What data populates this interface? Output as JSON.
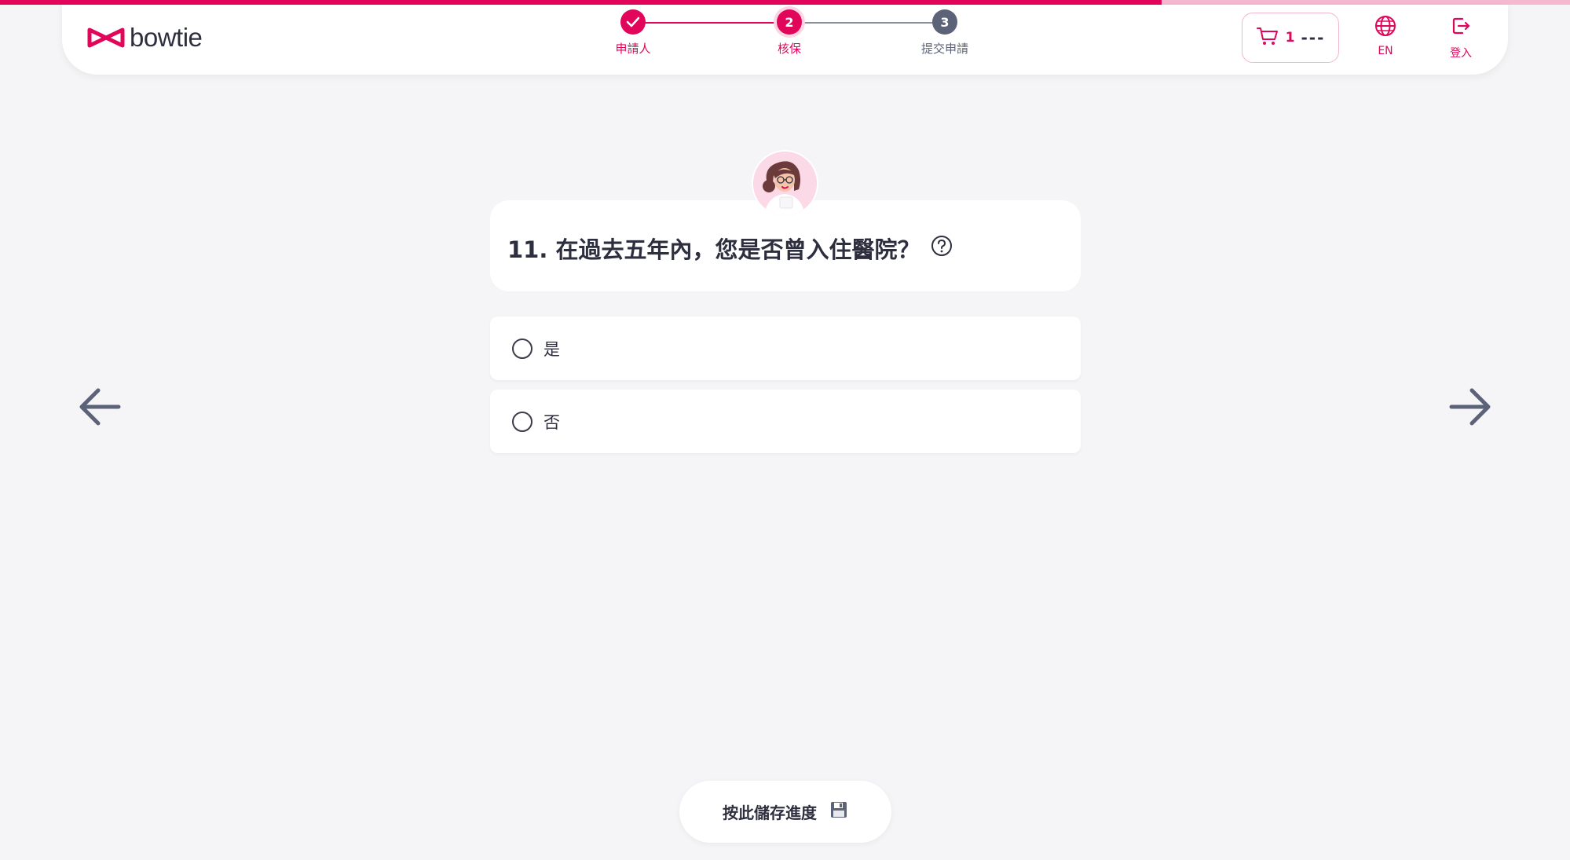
{
  "brand": {
    "name": "bowtie",
    "color": "#e2065b"
  },
  "progress": {
    "percent": 74
  },
  "stepper": {
    "steps": [
      {
        "label": "申請人",
        "number": "",
        "state": "completed"
      },
      {
        "label": "核保",
        "number": "2",
        "state": "active"
      },
      {
        "label": "提交申請",
        "number": "3",
        "state": "upcoming"
      }
    ]
  },
  "cart": {
    "count": "1",
    "amount": "---",
    "icon": "cart-icon"
  },
  "header_actions": {
    "language_label": "EN",
    "language_icon": "globe-icon",
    "login_label": "登入",
    "login_icon": "login-icon"
  },
  "question": {
    "text": "11. 在過去五年內，您是否曾入住醫院？",
    "help_icon": "question-circle-icon"
  },
  "options": [
    {
      "label": "是",
      "selected": false
    },
    {
      "label": "否",
      "selected": false
    }
  ],
  "navigation": {
    "back_icon": "arrow-left-icon",
    "next_icon": "arrow-right-icon"
  },
  "save": {
    "label": "按此儲存進度",
    "icon": "floppy-disk-icon"
  },
  "colors": {
    "accent": "#e2065b",
    "accent_light": "#f4b8cf",
    "text_dark": "#2e2f3e",
    "muted": "#5c6378",
    "background": "#f5f5f7"
  }
}
